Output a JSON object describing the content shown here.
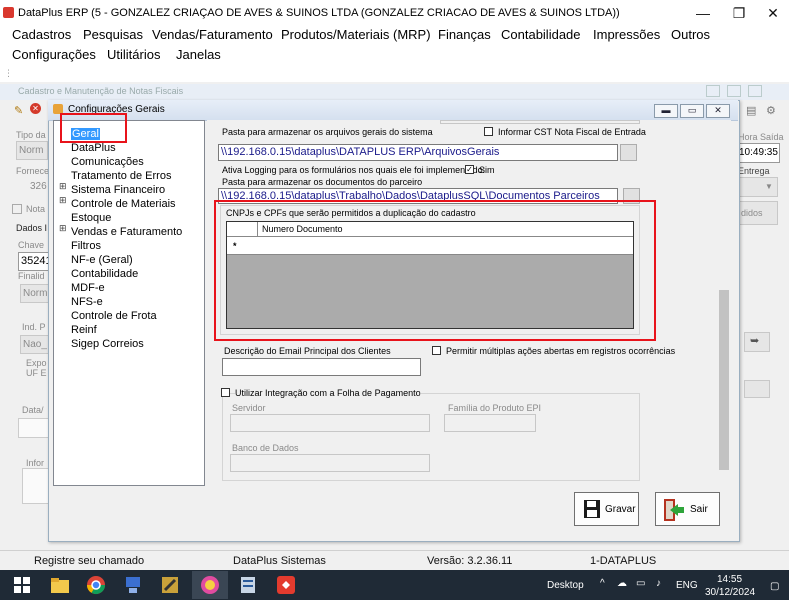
{
  "window": {
    "title": "DataPlus ERP (5 - GONZALEZ CRIAÇAO DE AVES & SUINOS LTDA  (GONZALEZ CRIACAO DE AVES & SUINOS LTDA))",
    "minimize": "—",
    "maximize": "❐",
    "close": "✕"
  },
  "menu": {
    "row1": [
      "Cadastros",
      "Pesquisas",
      "Vendas/Faturamento",
      "Produtos/Materiais (MRP)",
      "Finanças",
      "Contabilidade",
      "Impressões",
      "Outros"
    ],
    "row2": [
      "Configurações",
      "Utilitários",
      "Janelas"
    ]
  },
  "background_form": {
    "title": "Cadastro e Manutenção de Notas Fiscais",
    "labels": {
      "tipo": "Tipo da",
      "norm1": "Norm",
      "fornec": "Fornece",
      "num": "326",
      "nota": "Nota",
      "dados": "Dados I",
      "chave": "Chave",
      "chave_val": "35241",
      "finalid": "Finalid",
      "norm2": "Norm",
      "ind": "Ind. P",
      "nao": "Nao_",
      "expo": "Expo",
      "uf": "UF E",
      "data": "Data/",
      "info": "Infor",
      "hora_saida": "Hora Saída",
      "hora_val": "10:49:35",
      "entrega": "Entrega",
      "pedidos": "didos"
    }
  },
  "dialog": {
    "title": "Configurações Gerais",
    "tree": [
      {
        "label": "Geral",
        "expand": "",
        "selected": true
      },
      {
        "label": "DataPlus",
        "expand": ""
      },
      {
        "label": "Comunicações",
        "expand": ""
      },
      {
        "label": "Tratamento de Erros",
        "expand": ""
      },
      {
        "label": "Sistema Financeiro",
        "expand": "⊞"
      },
      {
        "label": "Controle de Materiais",
        "expand": "⊞"
      },
      {
        "label": "Estoque",
        "expand": ""
      },
      {
        "label": "Vendas e Faturamento",
        "expand": "⊞"
      },
      {
        "label": "Filtros",
        "expand": ""
      },
      {
        "label": "NF-e (Geral)",
        "expand": ""
      },
      {
        "label": "Contabilidade",
        "expand": ""
      },
      {
        "label": "MDF-e",
        "expand": ""
      },
      {
        "label": "NFS-e",
        "expand": ""
      },
      {
        "label": "Controle de Frota",
        "expand": ""
      },
      {
        "label": "Reinf",
        "expand": ""
      },
      {
        "label": "Sigep Correios",
        "expand": ""
      }
    ],
    "general": {
      "arquivos_label": "Pasta para armazenar os arquivos gerais do sistema",
      "arquivos_value": "\\\\192.168.0.15\\dataplus\\DATAPLUS ERP\\ArquivosGerais",
      "cst_label": "Informar CST Nota Fiscal de Entrada",
      "logging_label": "Ativa Logging para os formulários nos quais ele foi implementado:",
      "logging_value": "Sim",
      "parceiro_label": "Pasta para armazenar os documentos do parceiro",
      "parceiro_value": "\\\\192.168.0.15\\dataplus\\Trabalho\\Dados\\DataplusSQL\\Documentos Parceiros",
      "cnpj_group": "CNPJs e CPFs que serão permitidos a duplicação do cadastro",
      "grid_column": "Numero Documento",
      "grid_new_row": "*",
      "email_label": "Descrição do Email Principal dos Clientes",
      "email_value": "",
      "multiplas_label": "Permitir múltiplas ações abertas em registros ocorrências",
      "folha_label": "Utilizar Integração com a Folha de Pagamento",
      "servidor_label": "Servidor",
      "familia_label": "Família do Produto EPI",
      "banco_label": "Banco de Dados"
    },
    "buttons": {
      "save": "Gravar",
      "exit": "Sair"
    }
  },
  "statusbar": {
    "chamado": "Registre seu chamado",
    "empresa": "DataPlus Sistemas",
    "versao": "Versão: 3.2.36.11",
    "usuario": "1-DATAPLUS"
  },
  "taskbar": {
    "desktop": "Desktop",
    "chevron": "^",
    "lang": "ENG",
    "time": "14:55",
    "date": "30/12/2024"
  },
  "colors": {
    "highlight_red": "#e8131b",
    "path_text": "#1a1a8a",
    "taskbar": "#1f2a36"
  }
}
